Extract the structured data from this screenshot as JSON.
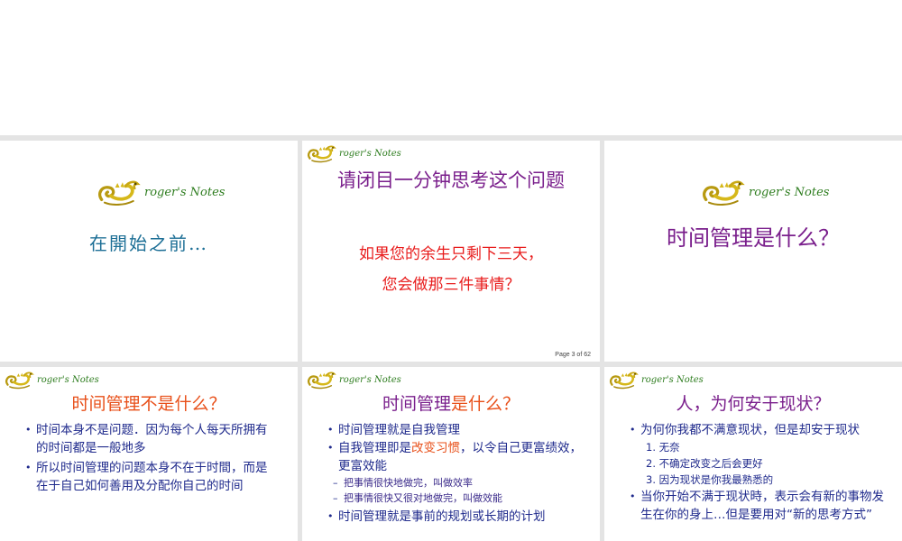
{
  "logo_text": "roger's Notes",
  "colors": {
    "purple": "#7a1f8c",
    "orange": "#e8501a",
    "red": "#e81c1c",
    "navy": "#1f2a8c",
    "teal": "#1d6f96",
    "logo_green": "#2e7d1f"
  },
  "slides": [
    {
      "title": "在開始之前…"
    },
    {
      "title": "请闭目一分钟思考这个问题",
      "line1": "如果您的余生只剩下三天，",
      "line2": "您会做那三件事情？",
      "page_number": "Page 3 of 62"
    },
    {
      "title": "时间管理是什么？"
    },
    {
      "title": "时间管理不是什么？",
      "bullets": [
        "时间本身不是问题．因为每个人每天所拥有的时间都是一般地多",
        "所以时间管理的问题本身不在于时間，而是在于自己如何善用及分配你自己的时间"
      ]
    },
    {
      "title_part1": "时间管理",
      "title_part2": "是什么？",
      "bullet1": "时间管理就是自我管理",
      "bullet2_pre": "自我管理即是",
      "bullet2_highlight": "改变习惯",
      "bullet2_post": "，以令自己更富绩效，更富效能",
      "sub1": "把事情很快地做完，叫做效率",
      "sub2": "把事情很快又很对地做完，叫做效能",
      "bullet3": "时间管理就是事前的规划或长期的计划"
    },
    {
      "title": "人，为何安于现状？",
      "bullet1": "为何你我都不满意现状，但是却安于现状",
      "numbered": [
        {
          "n": "1.",
          "text": "无奈"
        },
        {
          "n": "2.",
          "text": "不确定改变之后会更好"
        },
        {
          "n": "3.",
          "text": "因为现状是你我最熟悉的"
        }
      ],
      "bullet2": "当你开始不满于现状時，表示会有新的事物发生在你的身上…但是要用对“新的思考方式”"
    }
  ]
}
